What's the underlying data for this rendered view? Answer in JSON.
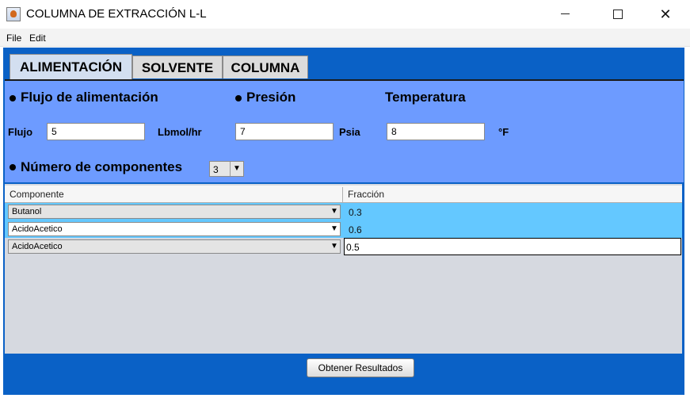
{
  "window": {
    "title": "COLUMNA DE EXTRACCIÓN L-L",
    "minimize": "—",
    "maximize": "☐",
    "close": "✕"
  },
  "menu": {
    "items": [
      "File",
      "Edit"
    ]
  },
  "tabs": [
    {
      "label": "ALIMENTACIÓN",
      "active": true
    },
    {
      "label": "SOLVENTE",
      "active": false
    },
    {
      "label": "COLUMNA",
      "active": false
    }
  ],
  "form": {
    "flujo_heading": "Flujo de alimentación",
    "presion_heading": "Presión",
    "temperatura_heading": "Temperatura",
    "flujo_label": "Flujo",
    "flujo_value": "5",
    "flujo_unit": "Lbmol/hr",
    "presion_value": "7",
    "presion_unit": "Psia",
    "temperatura_value": "8",
    "temperatura_unit": "°F",
    "componentes_heading": "Número de componentes",
    "componentes_value": "3"
  },
  "table": {
    "headers": [
      "Componente",
      "Fracción"
    ],
    "rows": [
      {
        "componente": "Butanol",
        "fraccion": "0.3",
        "selected": true
      },
      {
        "componente": "AcidoAcetico",
        "fraccion": "0.6",
        "selected": true
      },
      {
        "componente": "AcidoAcetico",
        "fraccion": "0.5",
        "editing": true
      }
    ]
  },
  "actions": {
    "results_button": "Obtener Resultados"
  },
  "colors": {
    "frame_blue": "#0a61c6",
    "panel_blue": "#6d9bff",
    "selection_blue": "#64c8ff",
    "table_bg": "#d6d9e0"
  }
}
